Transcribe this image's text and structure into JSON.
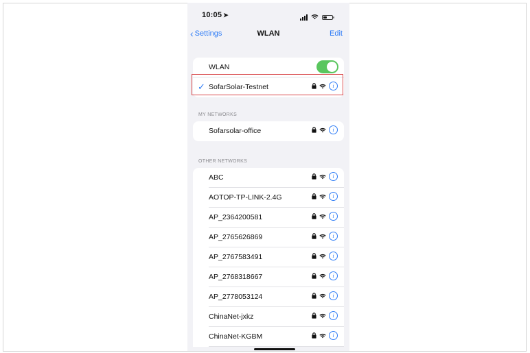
{
  "status_bar": {
    "time": "10:05",
    "time_arrow": "➤"
  },
  "nav": {
    "back_label": "Settings",
    "title": "WLAN",
    "edit_label": "Edit"
  },
  "wlan": {
    "label": "WLAN",
    "enabled": true
  },
  "connected": {
    "name": "SofarSolar-Testnet",
    "checkmark": "✓"
  },
  "sections": {
    "my_networks": "MY NETWORKS",
    "other_networks": "OTHER NETWORKS"
  },
  "my_networks": [
    {
      "name": "Sofarsolar-office"
    }
  ],
  "other_networks": [
    {
      "name": "ABC"
    },
    {
      "name": "AOTOP-TP-LINK-2.4G"
    },
    {
      "name": "AP_2364200581"
    },
    {
      "name": "AP_2765626869"
    },
    {
      "name": "AP_2767583491"
    },
    {
      "name": "AP_2768318667"
    },
    {
      "name": "AP_2778053124"
    },
    {
      "name": "ChinaNet-jxkz"
    },
    {
      "name": "ChinaNet-KGBM"
    }
  ],
  "icons": {
    "lock": "lock-icon",
    "wifi": "wifi-icon",
    "info": "info-icon",
    "info_glyph": "i"
  },
  "colors": {
    "accent": "#2e7cf6",
    "toggle_on": "#5ac65e",
    "highlight": "#d9474a",
    "background": "#f2f2f6"
  }
}
